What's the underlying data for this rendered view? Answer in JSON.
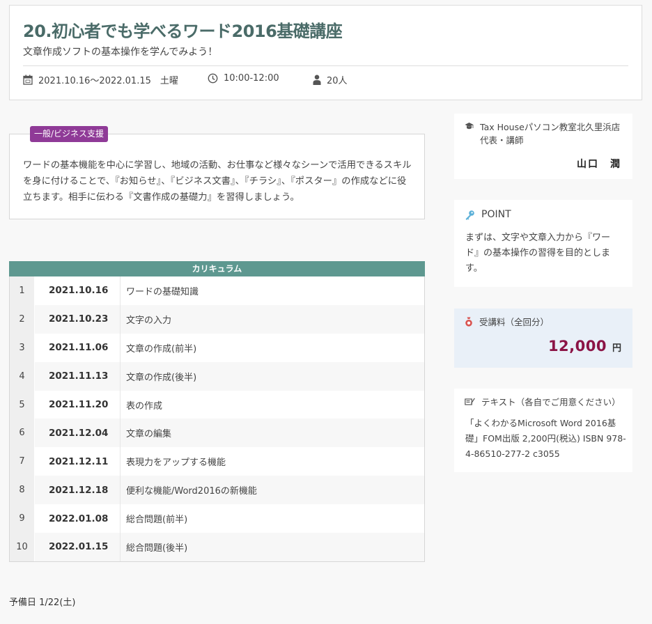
{
  "course": {
    "title": "20.初心者でも学べるワード2016基礎講座",
    "subtitle": "文章作成ソフトの基本操作を学んでみよう！",
    "date_range": "2021.10.16～2022.01.15　土曜",
    "time": "10:00-12:00",
    "capacity": "20人"
  },
  "description": {
    "category": "一般/ビジネス支援",
    "text": "ワードの基本機能を中心に学習し、地域の活動、お仕事など様々なシーンで活用できるスキルを身に付けることで、『お知らせ』、『ビジネス文書』、『チラシ』、『ポスター』の作成などに役立ちます。相手に伝わる『文書作成の基礎力』を習得しましょう。"
  },
  "curriculum": {
    "header": "カリキュラム",
    "rows": [
      {
        "no": "1",
        "date": "2021.10.16",
        "topic": "ワードの基礎知識"
      },
      {
        "no": "2",
        "date": "2021.10.23",
        "topic": "文字の入力"
      },
      {
        "no": "3",
        "date": "2021.11.06",
        "topic": "文章の作成(前半)"
      },
      {
        "no": "4",
        "date": "2021.11.13",
        "topic": "文章の作成(後半)"
      },
      {
        "no": "5",
        "date": "2021.11.20",
        "topic": "表の作成"
      },
      {
        "no": "6",
        "date": "2021.12.04",
        "topic": "文章の編集"
      },
      {
        "no": "7",
        "date": "2021.12.11",
        "topic": "表現力をアップする機能"
      },
      {
        "no": "8",
        "date": "2021.12.18",
        "topic": "便利な機能/Word2016の新機能"
      },
      {
        "no": "9",
        "date": "2022.01.08",
        "topic": "総合問題(前半)"
      },
      {
        "no": "10",
        "date": "2022.01.15",
        "topic": "総合問題(後半)"
      }
    ]
  },
  "reserve_day": "予備日 1/22(土)",
  "instructor": {
    "affiliation": "Tax Houseパソコン教室北久里浜店 代表・講師",
    "name": "山口　潤"
  },
  "point": {
    "heading": "POINT",
    "text": "まずは、文字や文章入力から『ワード』の基本操作の習得を目的とします。"
  },
  "fee": {
    "label": "受講料（全回分）",
    "amount": "12,000",
    "unit": "円"
  },
  "textbook": {
    "label": "テキスト（各自でご用意ください）",
    "text": "「よくわかるMicrosoft Word 2016基礎」FOM出版 2,200円(税込) ISBN 978-4-86510-277-2 c3055"
  },
  "colors": {
    "title": "#4a6b68",
    "badge": "#8f3a97",
    "table_header": "#5e9890",
    "fee_amount": "#8b1446",
    "fee_bg": "#e9f0f8"
  },
  "icons": [
    "calendar-icon",
    "clock-icon",
    "person-icon",
    "graduation-cap-icon",
    "key-icon",
    "money-bag-icon",
    "pen-book-icon"
  ]
}
